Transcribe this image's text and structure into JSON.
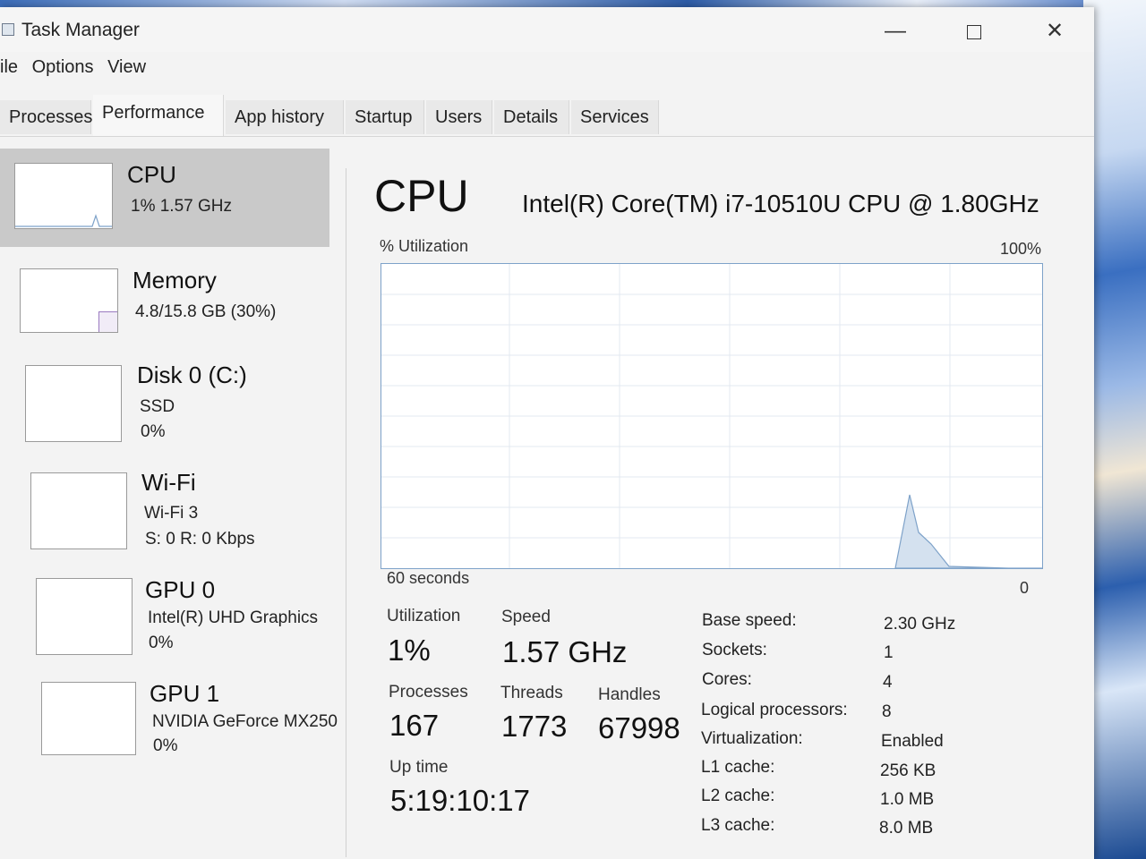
{
  "window": {
    "title": "Task Manager"
  },
  "menu": [
    "ile",
    "Options",
    "View"
  ],
  "tabs": [
    {
      "label": "Processes"
    },
    {
      "label": "Performance"
    },
    {
      "label": "App history"
    },
    {
      "label": "Startup"
    },
    {
      "label": "Users"
    },
    {
      "label": "Details"
    },
    {
      "label": "Services"
    }
  ],
  "sidebar": [
    {
      "title": "CPU",
      "lines": [
        "1%  1.57 GHz"
      ]
    },
    {
      "title": "Memory",
      "lines": [
        "4.8/15.8 GB (30%)"
      ]
    },
    {
      "title": "Disk 0 (C:)",
      "lines": [
        "SSD",
        "0%"
      ]
    },
    {
      "title": "Wi-Fi",
      "lines": [
        "Wi-Fi 3",
        "S: 0  R: 0 Kbps"
      ]
    },
    {
      "title": "GPU 0",
      "lines": [
        "Intel(R) UHD Graphics",
        "0%"
      ]
    },
    {
      "title": "GPU 1",
      "lines": [
        "NVIDIA GeForce MX250",
        "0%"
      ]
    }
  ],
  "main": {
    "title": "CPU",
    "cpu_name": "Intel(R) Core(TM) i7-10510U CPU @ 1.80GHz",
    "graph_label": "% Utilization",
    "graph_max": "100%",
    "graph_time": "60 seconds",
    "graph_min": "0",
    "stats": {
      "utilization_label": "Utilization",
      "utilization": "1%",
      "speed_label": "Speed",
      "speed": "1.57 GHz",
      "processes_label": "Processes",
      "processes": "167",
      "threads_label": "Threads",
      "threads": "1773",
      "handles_label": "Handles",
      "handles": "67998",
      "uptime_label": "Up time",
      "uptime": "5:19:10:17"
    },
    "specs": [
      {
        "label": "Base speed:",
        "value": "2.30 GHz"
      },
      {
        "label": "Sockets:",
        "value": "1"
      },
      {
        "label": "Cores:",
        "value": "4"
      },
      {
        "label": "Logical processors:",
        "value": "8"
      },
      {
        "label": "Virtualization:",
        "value": "Enabled"
      },
      {
        "label": "L1 cache:",
        "value": "256 KB"
      },
      {
        "label": "L2 cache:",
        "value": "1.0 MB"
      },
      {
        "label": "L3 cache:",
        "value": "8.0 MB"
      }
    ]
  },
  "icons": {
    "minimize": "minimize-icon",
    "maximize": "maximize-icon",
    "close": "close-icon",
    "app": "task-manager-icon"
  },
  "colors": {
    "graph_border": "#7ea2c9",
    "graph_fill": "#d4e1ef",
    "selected_item": "#c9c9c9"
  }
}
